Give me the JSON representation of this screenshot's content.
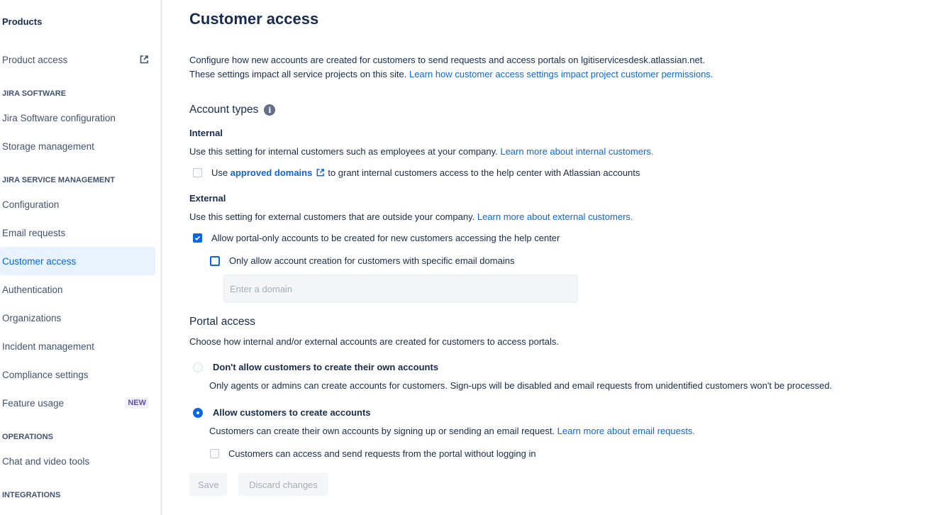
{
  "sidebar": {
    "title": "Products",
    "product_access": "Product access",
    "sections": {
      "jira_software": "JIRA SOFTWARE",
      "jsm": "JIRA SERVICE MANAGEMENT",
      "operations": "OPERATIONS",
      "integrations": "INTEGRATIONS"
    },
    "jira_software_items": [
      "Jira Software configuration",
      "Storage management"
    ],
    "jsm_items": [
      {
        "label": "Configuration",
        "active": false
      },
      {
        "label": "Email requests",
        "active": false
      },
      {
        "label": "Customer access",
        "active": true
      },
      {
        "label": "Authentication",
        "active": false
      },
      {
        "label": "Organizations",
        "active": false
      },
      {
        "label": "Incident management",
        "active": false
      },
      {
        "label": "Compliance settings",
        "active": false
      },
      {
        "label": "Feature usage",
        "active": false,
        "badge": "NEW"
      }
    ],
    "operations_items": [
      "Chat and video tools"
    ]
  },
  "page": {
    "title": "Customer access",
    "intro_line1": "Configure how new accounts are created for customers to send requests and access portals on lgitiservicesdesk.atlassian.net.",
    "intro_line2_text": "These settings impact all service projects on this site. ",
    "intro_line2_link": "Learn how customer access settings impact project customer permissions."
  },
  "account_types": {
    "heading": "Account types",
    "info_icon": "i",
    "internal": {
      "heading": "Internal",
      "desc": "Use this setting for internal customers such as employees at your company. ",
      "link": "Learn more about internal customers.",
      "checkbox_prefix": "Use ",
      "checkbox_link": "approved domains",
      "checkbox_suffix": " to grant internal customers access to the help center with Atlassian accounts",
      "checked": false
    },
    "external": {
      "heading": "External",
      "desc": "Use this setting for external customers that are outside your company. ",
      "link": "Learn more about external customers.",
      "portal_only_label": "Allow portal-only accounts to be created for new customers accessing the help center",
      "portal_only_checked": true,
      "specific_domains_label": "Only allow account creation for customers with specific email domains",
      "specific_domains_checked": false,
      "domain_placeholder": "Enter a domain",
      "domain_value": ""
    }
  },
  "portal_access": {
    "heading": "Portal access",
    "desc": "Choose how internal and/or external accounts are created for customers to access portals.",
    "options": [
      {
        "label": "Don't allow customers to create their own accounts",
        "desc": "Only agents or admins can create accounts for customers. Sign-ups will be disabled and email requests from unidentified customers won't be processed.",
        "selected": false
      },
      {
        "label": "Allow customers to create accounts",
        "desc": "Customers can create their own accounts by signing up or sending an email request. ",
        "link": "Learn more about email requests.",
        "selected": true
      }
    ],
    "anonymous_label": "Customers can access and send requests from the portal without logging in",
    "anonymous_checked": false
  },
  "actions": {
    "save": "Save",
    "discard": "Discard changes"
  },
  "colors": {
    "accent": "#0c66e4",
    "text": "#172b4d",
    "active_bg": "#e9f2ff",
    "badge_bg": "#f3f0ff",
    "badge_text": "#5e4db2"
  }
}
